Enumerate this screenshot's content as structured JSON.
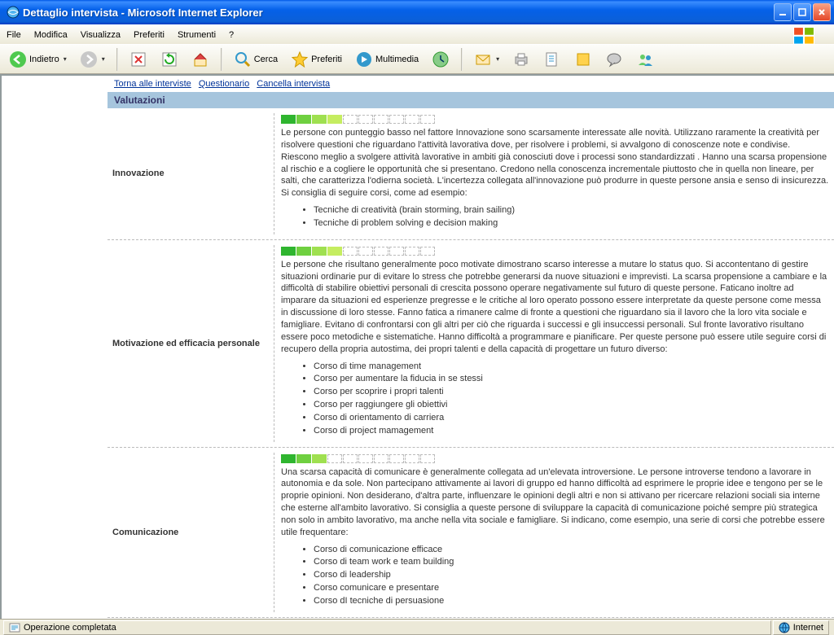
{
  "window": {
    "title": "Dettaglio intervista - Microsoft Internet Explorer"
  },
  "menu": {
    "file": "File",
    "modifica": "Modifica",
    "visualizza": "Visualizza",
    "preferiti": "Preferiti",
    "strumenti": "Strumenti",
    "help": "?"
  },
  "toolbar": {
    "back": "Indietro",
    "search": "Cerca",
    "favorites": "Preferiti",
    "multimedia": "Multimedia"
  },
  "toplinks": {
    "torna": "Torna alle interviste",
    "questionario": "Questionario",
    "cancella": "Cancella intervista"
  },
  "section": {
    "title": "Valutazioni"
  },
  "evals": [
    {
      "label": "Innovazione",
      "score": 4,
      "text": "Le persone con punteggio basso nel fattore Innovazione sono scarsamente interessate alle novità. Utilizzano raramente la creatività per risolvere questioni che riguardano l'attività lavorativa dove, per risolvere i problemi, si avvalgono di conoscenze note e condivise. Riescono meglio a svolgere attività lavorative in ambiti già conosciuti dove i processi sono standardizzati . Hanno una scarsa propensione al rischio e a cogliere le opportunità che si presentano. Credono nella conoscenza incrementale piuttosto che in quella non lineare, per salti, che caratterizza l'odierna società. L'incertezza collegata all'innovazione può produrre in queste persone ansia e senso di insicurezza. Si consiglia di seguire corsi, come ad esempio:",
      "bullets": [
        "Tecniche di creatività (brain storming, brain sailing)",
        "Tecniche di problem solving e decision making"
      ]
    },
    {
      "label": "Motivazione ed efficacia personale",
      "score": 4,
      "text": "Le persone che risultano generalmente poco motivate dimostrano scarso interesse a mutare lo status quo. Si accontentano di gestire situazioni ordinarie pur di evitare lo stress che potrebbe generarsi da nuove situazioni e imprevisti. La scarsa propensione a cambiare e la difficoltà di stabilire obiettivi personali di crescita possono operare negativamente sul futuro di queste persone. Faticano inoltre ad imparare da situazioni ed esperienze pregresse e le critiche al loro operato possono essere interpretate da queste persone come messa in discussione di loro stesse. Fanno fatica a rimanere calme di fronte a questioni che riguardano sia il lavoro che la loro vita sociale e famigliare. Evitano di confrontarsi con gli altri per ciò che riguarda i successi e gli insuccessi personali. Sul fronte lavorativo risultano essere poco metodiche e sistematiche. Hanno difficoltà a programmare e pianificare. Per queste persone può essere utile seguire corsi di recupero della propria autostima, dei propri talenti e della capacità di progettare un futuro diverso:",
      "bullets": [
        "Corso di time management",
        "Corso per aumentare la fiducia in se stessi",
        "Corso per scoprire i propri talenti",
        "Corso per raggiungere gli obiettivi",
        "Corso di orientamento di carriera",
        "Corso di project mamagement"
      ]
    },
    {
      "label": "Comunicazione",
      "score": 3,
      "text": "Una scarsa capacità di comunicare è generalmente collegata ad un'elevata introversione. Le persone introverse tendono a lavorare in autonomia e da sole. Non partecipano attivamente ai lavori di gruppo ed hanno difficoltà ad esprimere le proprie idee e tengono per se le proprie opinioni. Non desiderano, d'altra parte, influenzare le opinioni degli altri e non si attivano per ricercare relazioni sociali sia interne che esterne all'ambito lavorativo. Si consiglia a queste persone di sviluppare la capacità di comunicazione poiché sempre più strategica non solo in ambito lavorativo, ma anche nella vita sociale e famigliare. Si indicano, come esempio, una serie di corsi che potrebbe essere utile frequentare:",
      "bullets": [
        "Corso di comunicazione efficace",
        "Corso di team work e team building",
        "Corso di leadership",
        "Corso comunicare e presentare",
        "Corso dI tecniche di persuasione"
      ]
    }
  ],
  "status": {
    "done": "Operazione completata",
    "zone": "Internet"
  }
}
